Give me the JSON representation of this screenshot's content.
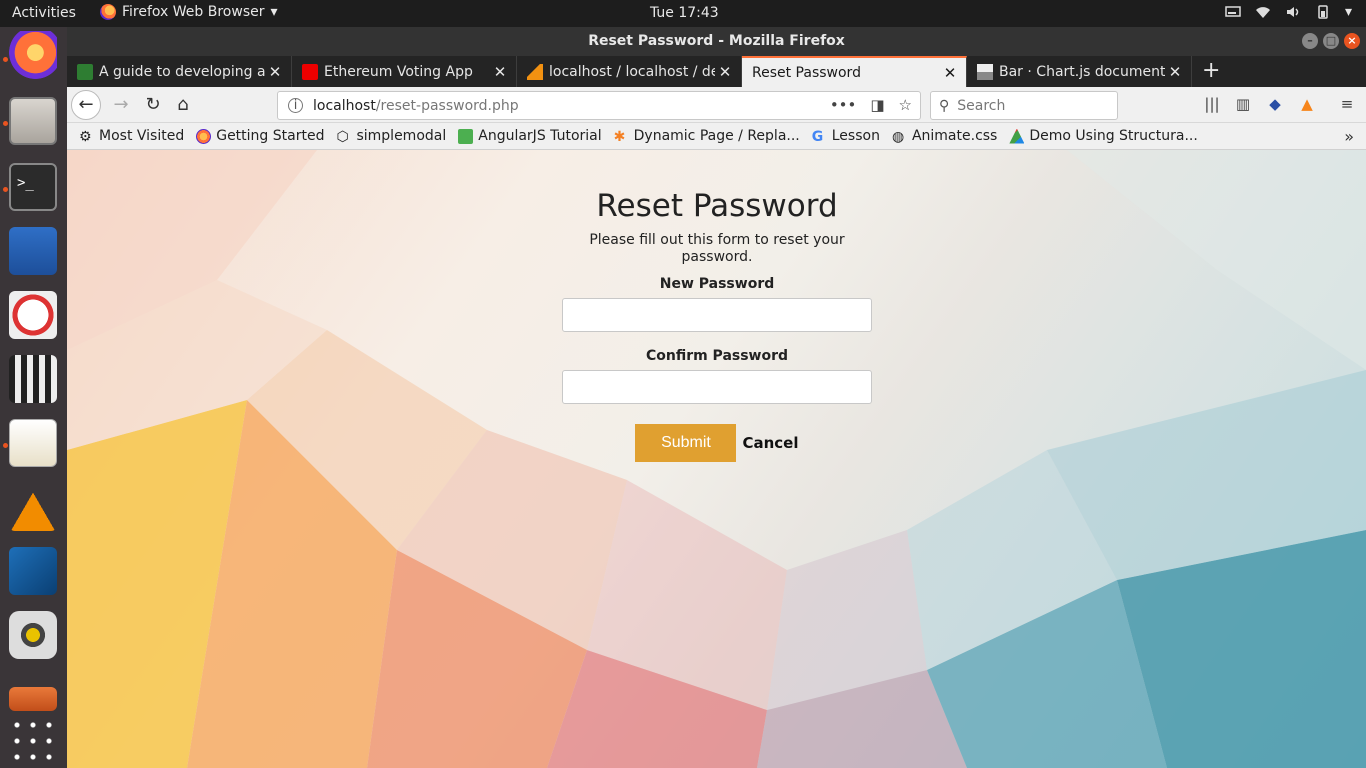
{
  "topbar": {
    "activities": "Activities",
    "app_name": "Firefox Web Browser",
    "clock": "Tue 17:43"
  },
  "window": {
    "title": "Reset Password - Mozilla Firefox"
  },
  "tabs": [
    {
      "title": "A guide to developing an",
      "active": false
    },
    {
      "title": "Ethereum Voting App",
      "active": false
    },
    {
      "title": "localhost / localhost / de",
      "active": false
    },
    {
      "title": "Reset Password",
      "active": true
    },
    {
      "title": "Bar · Chart.js documenta",
      "active": false
    }
  ],
  "urlbar": {
    "host": "localhost",
    "path": "/reset-password.php"
  },
  "searchbar": {
    "placeholder": "Search"
  },
  "bookmarks": [
    {
      "label": "Most Visited"
    },
    {
      "label": "Getting Started"
    },
    {
      "label": "simplemodal"
    },
    {
      "label": "AngularJS Tutorial"
    },
    {
      "label": "Dynamic Page / Repla..."
    },
    {
      "label": "Lesson"
    },
    {
      "label": "Animate.css"
    },
    {
      "label": "Demo Using Structura..."
    }
  ],
  "form": {
    "heading": "Reset Password",
    "subtitle": "Please fill out this form to reset your password.",
    "new_password_label": "New Password",
    "new_password_value": "",
    "confirm_password_label": "Confirm Password",
    "confirm_password_value": "",
    "submit_label": "Submit",
    "cancel_label": "Cancel"
  },
  "colors": {
    "accent": "#e0a030",
    "ubuntu_orange": "#e95420",
    "tab_highlight": "#ff7139"
  }
}
